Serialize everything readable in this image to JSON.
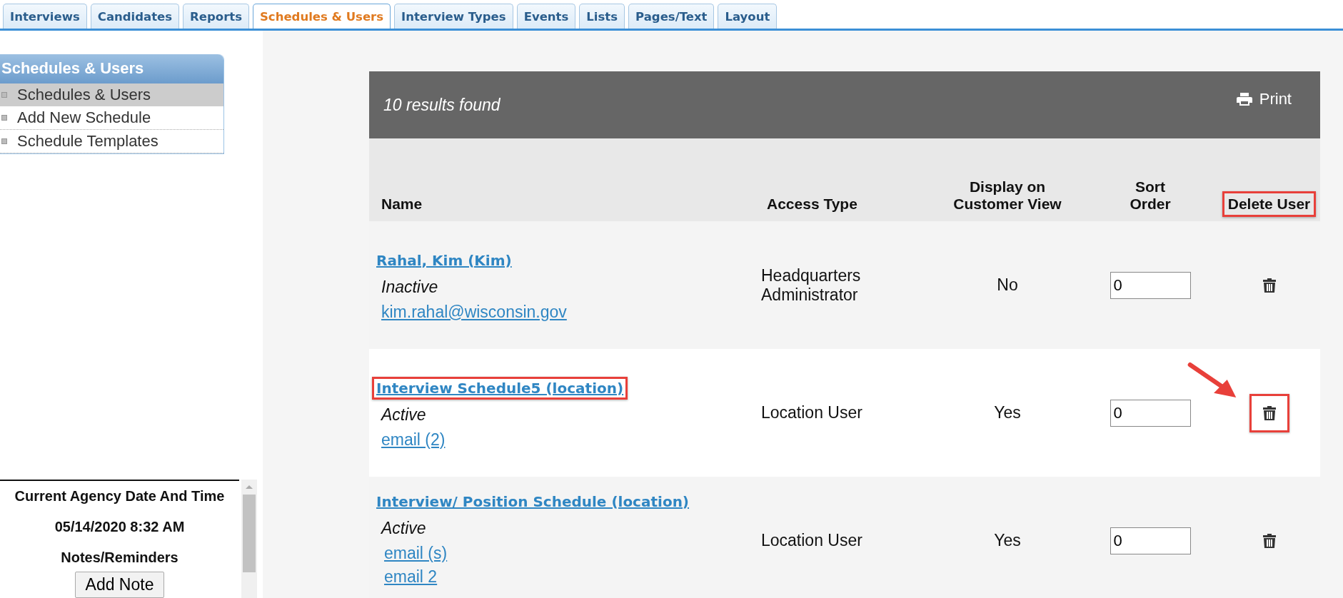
{
  "tabs": [
    {
      "label": "Interviews",
      "selected": false
    },
    {
      "label": "Candidates",
      "selected": false
    },
    {
      "label": "Reports",
      "selected": false
    },
    {
      "label": "Schedules & Users",
      "selected": true
    },
    {
      "label": "Interview Types",
      "selected": false
    },
    {
      "label": "Events",
      "selected": false
    },
    {
      "label": "Lists",
      "selected": false
    },
    {
      "label": "Pages/Text",
      "selected": false
    },
    {
      "label": "Layout",
      "selected": false
    }
  ],
  "sidebar": {
    "title": "Schedules & Users",
    "items": [
      {
        "label": "Schedules & Users",
        "selected": true
      },
      {
        "label": "Add New Schedule",
        "selected": false
      },
      {
        "label": "Schedule Templates",
        "selected": false
      }
    ]
  },
  "info_panel": {
    "heading": "Current Agency Date And Time",
    "datetime": "05/14/2020 8:32 AM",
    "notes_heading": "Notes/Reminders",
    "button": "Add Note"
  },
  "results": {
    "summary": "10 results found",
    "print": "Print"
  },
  "table": {
    "columns": [
      {
        "label": "Name",
        "highlighted": false
      },
      {
        "label": "Access Type",
        "highlighted": false
      },
      {
        "label": "Display on Customer View",
        "highlighted": false
      },
      {
        "label": "Sort Order",
        "highlighted": false
      },
      {
        "label": "Delete User",
        "highlighted": true
      }
    ],
    "rows": [
      {
        "name": "Rahal, Kim (Kim)",
        "name_highlighted": false,
        "status": "Inactive",
        "emails": [
          "kim.rahal@wisconsin.gov"
        ],
        "access_type": "Headquarters Administrator",
        "display": "No",
        "sort_order": "0",
        "delete_highlighted": false
      },
      {
        "name": "Interview Schedule5 (location)",
        "name_highlighted": true,
        "status": "Active",
        "emails": [
          "email (2)"
        ],
        "access_type": "Location User",
        "display": "Yes",
        "sort_order": "0",
        "delete_highlighted": true
      },
      {
        "name": "Interview/ Position Schedule (location)",
        "name_highlighted": false,
        "status": "Active",
        "emails": [
          "email (s)",
          "email 2"
        ],
        "access_type": "Location User",
        "display": "Yes",
        "sort_order": "0",
        "delete_highlighted": false
      }
    ]
  }
}
